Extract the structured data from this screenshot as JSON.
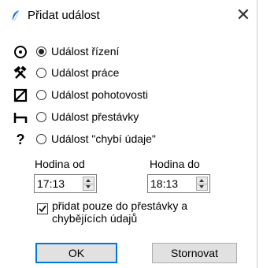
{
  "window": {
    "title": "Přidat událost",
    "close_glyph": "✕",
    "icon": "app-feather-icon"
  },
  "events": [
    {
      "label": "Událost řízení",
      "icon": "steering-wheel-icon",
      "checked": true
    },
    {
      "label": "Událost práce",
      "icon": "hammer-tools-icon",
      "checked": false
    },
    {
      "label": "Událost pohotovosti",
      "icon": "standby-box-icon",
      "checked": false
    },
    {
      "label": "Událost přestávky",
      "icon": "bed-break-icon",
      "checked": false
    },
    {
      "label": "Událost \"chybí údaje\"",
      "icon": "question-mark-icon",
      "checked": false
    }
  ],
  "time": {
    "from_label": "Hodina od",
    "from_value": "17:13",
    "to_label": "Hodina do",
    "to_value": "18:13"
  },
  "option": {
    "label": "přidat pouze do přestávky a chybějících údajů",
    "checked": true
  },
  "buttons": {
    "ok": "OK",
    "cancel": "Stornovat"
  }
}
